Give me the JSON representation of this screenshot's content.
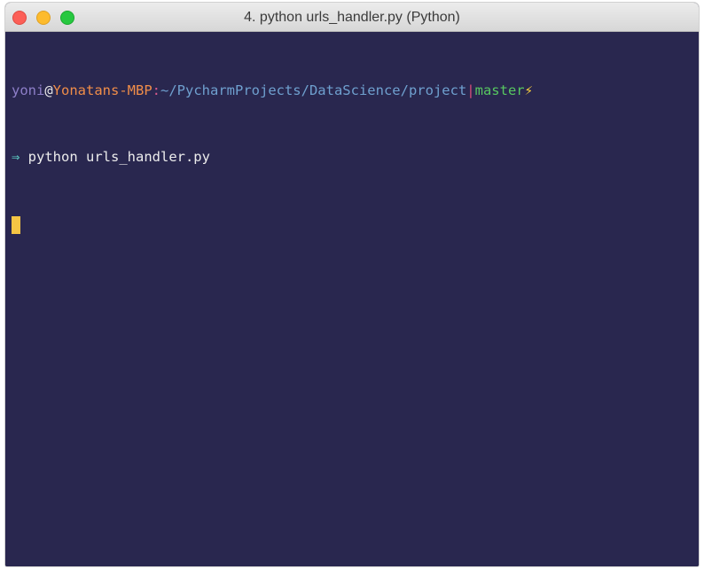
{
  "window": {
    "title": "4. python urls_handler.py (Python)"
  },
  "prompt": {
    "user": "yoni",
    "at": "@",
    "host": "Yonatans-MBP",
    "colon": ":",
    "path": "~/PycharmProjects/DataScience/project",
    "separator": "|",
    "branch": "master",
    "status_icon": "⚡"
  },
  "command": {
    "arrow": "⇒",
    "text": " python urls_handler.py"
  },
  "colors": {
    "terminal_background": "#29274f",
    "cursor": "#f5c544"
  }
}
